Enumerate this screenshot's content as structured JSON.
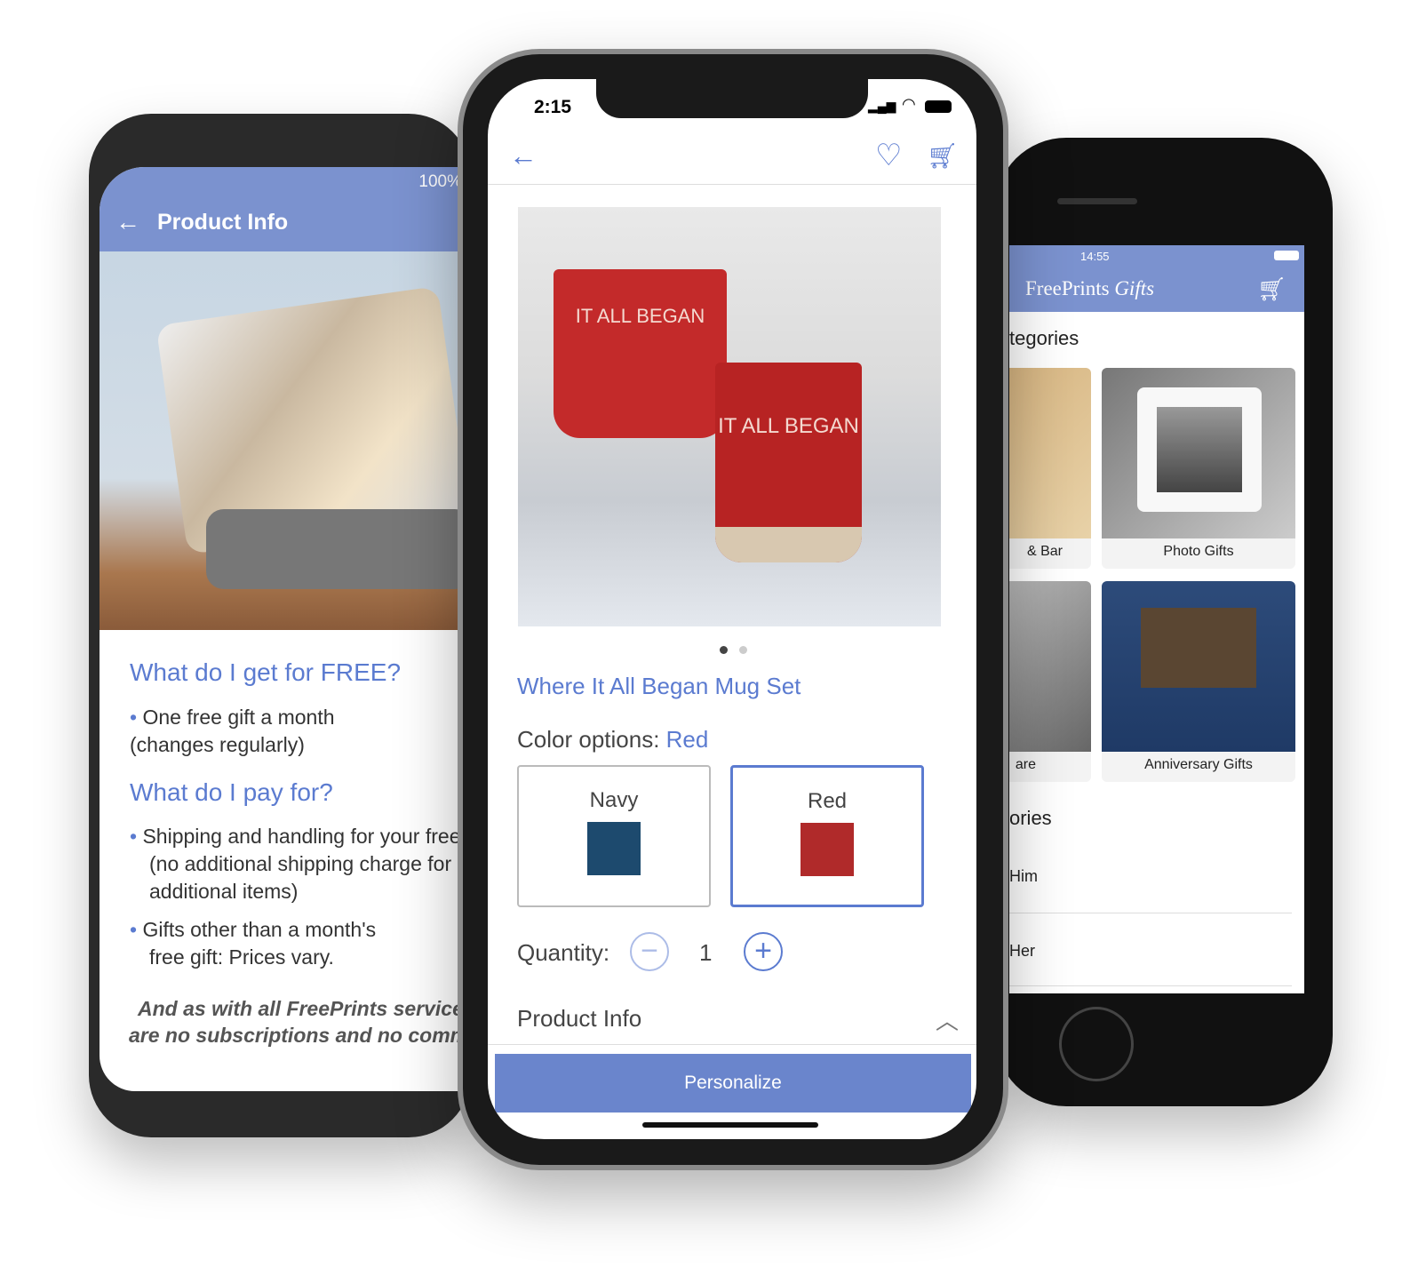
{
  "left_phone": {
    "status_battery": "100%",
    "title": "Product Info",
    "heading1": "What do I get for FREE?",
    "bullets1": [
      "One free gift a month (changes regularly)"
    ],
    "heading2": "What do I pay for?",
    "bullets2": [
      "Shipping and handling for your free gift (no additional shipping charge for additional items)",
      "Gifts other than a month's free gift: Prices vary."
    ],
    "footer_line1": "And as with all FreePrints services, there",
    "footer_line2": "are no subscriptions and no commitments."
  },
  "middle_phone": {
    "time": "2:15",
    "product_title": "Where It All Began Mug Set",
    "mug_text": "IT ALL BEGAN",
    "color_label": "Color options:",
    "color_selected": "Red",
    "colors": [
      {
        "name": "Navy",
        "hex": "#1d4a6e"
      },
      {
        "name": "Red",
        "hex": "#b02a2a"
      }
    ],
    "quantity_label": "Quantity:",
    "quantity": "1",
    "product_info_label": "Product Info",
    "cta": "Personalize",
    "carousel_pages": 2,
    "carousel_active": 1
  },
  "right_phone": {
    "time": "14:55",
    "brand": "FreePrints",
    "brand_script": "Gifts",
    "categories_heading": "tegories",
    "tiles": [
      "& Bar",
      "Photo Gifts",
      "are",
      "Anniversary Gifts"
    ],
    "stories_heading": "ories",
    "list": [
      "Him",
      "Her"
    ]
  },
  "colors": {
    "accent": "#5b7bd0",
    "header": "#7b92cf",
    "cta": "#6a85cc"
  }
}
